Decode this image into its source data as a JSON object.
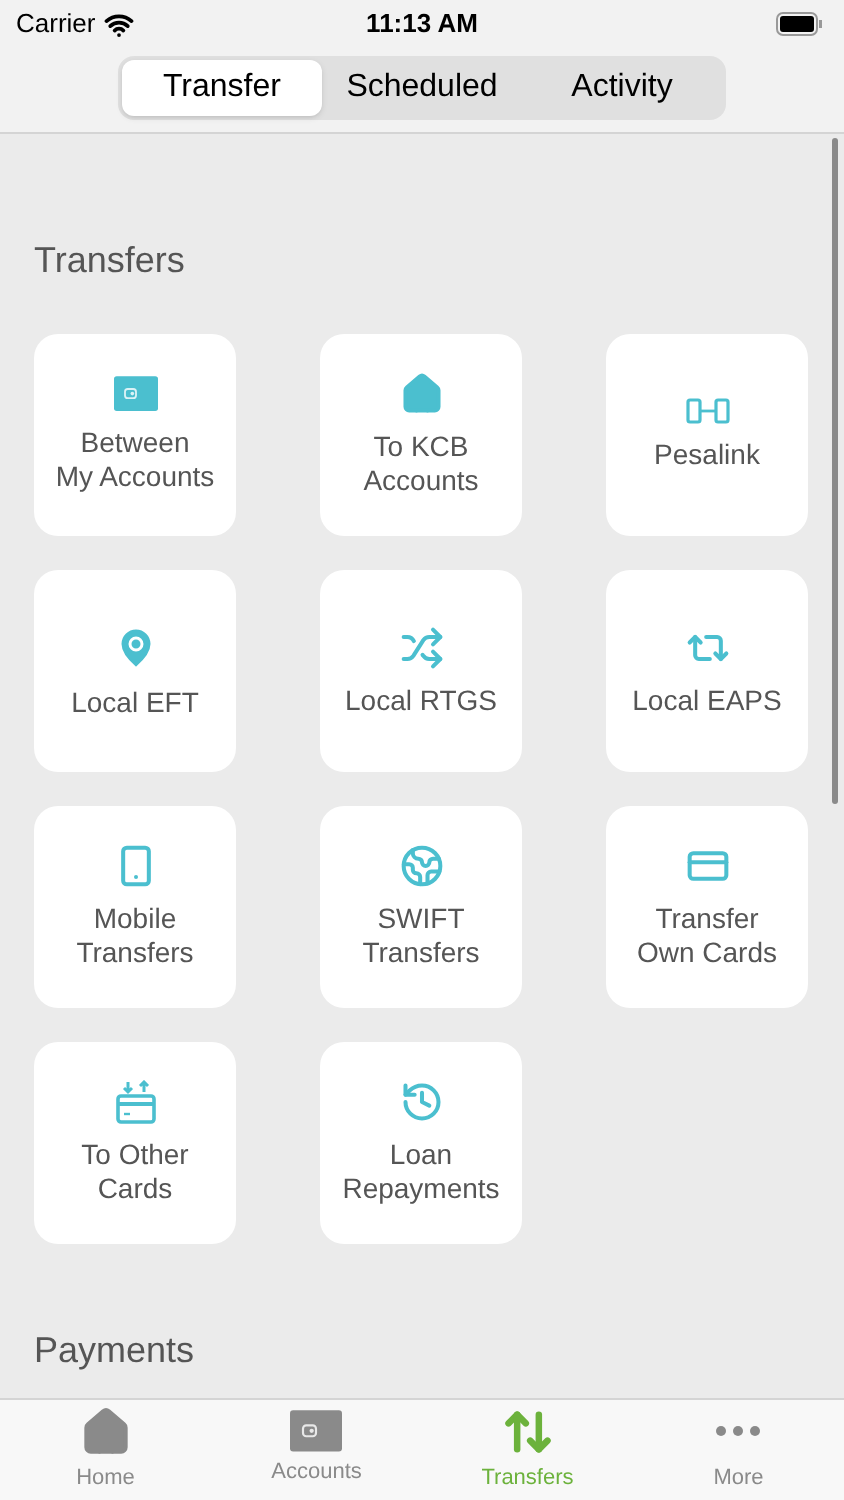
{
  "status_bar": {
    "carrier": "Carrier",
    "time": "11:13 AM"
  },
  "segments": [
    {
      "label": "Transfer",
      "selected": true
    },
    {
      "label": "Scheduled",
      "selected": false
    },
    {
      "label": "Activity",
      "selected": false
    }
  ],
  "sections": [
    {
      "title": "Transfers",
      "tiles": [
        {
          "label": "Between\nMy Accounts"
        },
        {
          "label": "To KCB\nAccounts"
        },
        {
          "label": "Pesalink"
        },
        {
          "label": "Local EFT"
        },
        {
          "label": "Local RTGS"
        },
        {
          "label": "Local EAPS"
        },
        {
          "label": "Mobile\nTransfers"
        },
        {
          "label": "SWIFT\nTransfers"
        },
        {
          "label": "Transfer\nOwn Cards"
        },
        {
          "label": "To Other\nCards"
        },
        {
          "label": "Loan\nRepayments"
        }
      ]
    },
    {
      "title": "Payments"
    }
  ],
  "tab_bar": [
    {
      "label": "Home",
      "selected": false
    },
    {
      "label": "Accounts",
      "selected": false
    },
    {
      "label": "Transfers",
      "selected": true
    },
    {
      "label": "More",
      "selected": false
    }
  ]
}
